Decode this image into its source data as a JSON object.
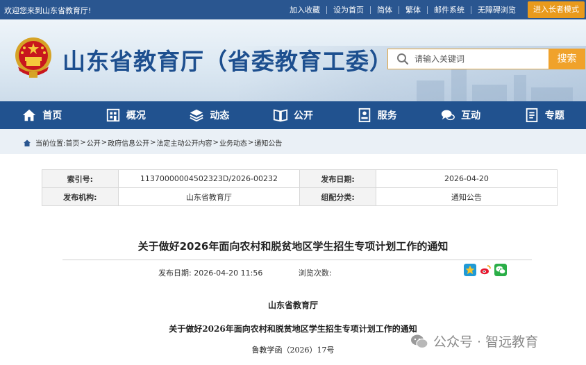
{
  "topbar": {
    "welcome": "欢迎您来到山东省教育厅!",
    "links": [
      "加入收藏",
      "设为首页",
      "简体",
      "繁体",
      "邮件系统",
      "无障碍浏览"
    ],
    "elder_mode": "进入长者模式"
  },
  "header": {
    "site_title": "山东省教育厅（省委教育工委）",
    "search_placeholder": "请输入关键词",
    "search_button": "搜索"
  },
  "nav": [
    "首页",
    "概况",
    "动态",
    "公开",
    "服务",
    "互动",
    "专题"
  ],
  "breadcrumb": {
    "prefix": "当前位置:",
    "items": [
      "首页",
      "公开",
      "政府信息公开",
      "法定主动公开内容",
      "业务动态",
      "通知公告"
    ]
  },
  "meta": {
    "index_label": "索引号:",
    "index_value": "11370000004502323D/2026-00232",
    "date_label": "发布日期:",
    "date_value": "2026-04-20",
    "org_label": "发布机构:",
    "org_value": "山东省教育厅",
    "cat_label": "组配分类:",
    "cat_value": "通知公告"
  },
  "article": {
    "title": "关于做好2026年面向农村和脱贫地区学生招生专项计划工作的通知",
    "pub_label": "发布日期:",
    "pub_value": "2026-04-20 11:56",
    "views_label": "浏览次数:",
    "line1": "山东省教育厅",
    "line2": "关于做好2026年面向农村和脱贫地区学生招生专项计划工作的通知",
    "line3": "鲁教学函（2026）17号"
  },
  "watermark": "公众号 · 智远教育",
  "colors": {
    "topbar": "#2a5690",
    "nav": "#21528f",
    "accent": "#f0a22b",
    "title": "#1d4f8f"
  }
}
